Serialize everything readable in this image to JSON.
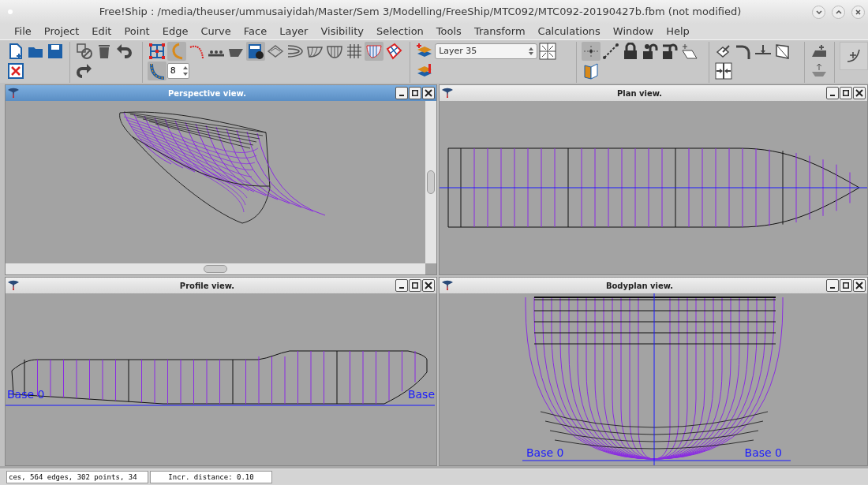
{
  "window": {
    "title": "Free!Ship  : /media/theuser/ummusaiyidah/Master/Sem 3/Modelling/FreeShip/MTC092/MTC092-20190427b.fbm (not modified)"
  },
  "menu": [
    "File",
    "Project",
    "Edit",
    "Point",
    "Edge",
    "Curve",
    "Face",
    "Layer",
    "Visibility",
    "Selection",
    "Tools",
    "Transform",
    "Calculations",
    "Window",
    "Help"
  ],
  "toolbar": {
    "spin_value": "8",
    "layer": "Layer 35"
  },
  "views": [
    {
      "title": "Perspective view.",
      "kind": "perspective",
      "active": true
    },
    {
      "title": "Plan view.",
      "kind": "plan",
      "active": false
    },
    {
      "title": "Profile view.",
      "kind": "profile",
      "active": false,
      "labels": [
        "Base 0",
        "Base"
      ]
    },
    {
      "title": "Bodyplan view.",
      "kind": "bodyplan",
      "active": false,
      "labels": [
        "Base 0",
        "Base 0"
      ]
    }
  ],
  "status_bar": [
    "ces, 564 edges, 302 points, 34",
    "Incr. distance: 0.10"
  ]
}
